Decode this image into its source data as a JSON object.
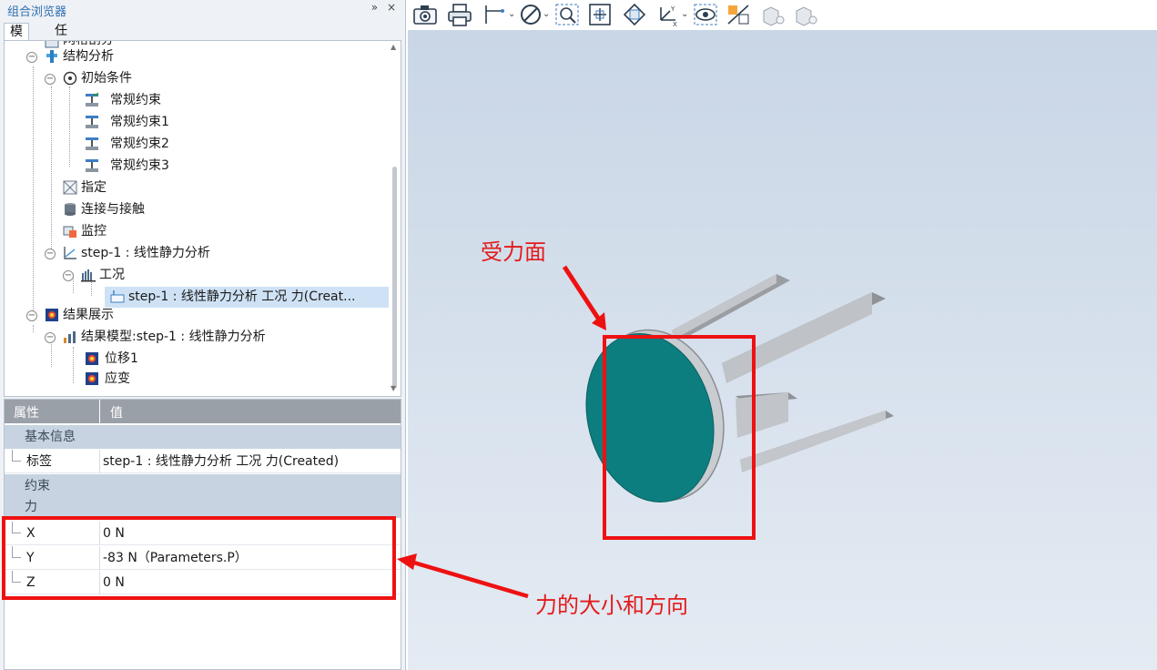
{
  "panel": {
    "title": "组合浏览器",
    "buttons": "» ×"
  },
  "tabs": [
    "模型",
    "任务"
  ],
  "tree": {
    "partial_top": "网格剖分",
    "items": [
      {
        "label": "结构分析",
        "icon": "analysis-icon"
      },
      {
        "label": "初始条件",
        "icon": "initial-condition-icon"
      },
      {
        "label": "常规约束",
        "icon": "constraint-icon"
      },
      {
        "label": "常规约束1",
        "icon": "constraint-icon"
      },
      {
        "label": "常规约束2",
        "icon": "constraint-icon"
      },
      {
        "label": "常规约束3",
        "icon": "constraint-icon"
      },
      {
        "label": "指定",
        "icon": "assign-icon"
      },
      {
        "label": "连接与接触",
        "icon": "contact-icon"
      },
      {
        "label": "监控",
        "icon": "monitor-icon"
      },
      {
        "label": "step-1 : 线性静力分析",
        "icon": "step-icon"
      },
      {
        "label": "工况",
        "icon": "load-case-icon"
      },
      {
        "label": "step-1 : 线性静力分析 工况 力(Creat...",
        "icon": "force-icon"
      },
      {
        "label": "结果展示",
        "icon": "results-icon"
      },
      {
        "label": "结果模型:step-1 : 线性静力分析",
        "icon": "result-model-icon"
      },
      {
        "label": "位移1",
        "icon": "contour-icon"
      },
      {
        "label": "应变",
        "icon": "contour-icon"
      }
    ]
  },
  "properties": {
    "header": {
      "property": "属性",
      "value": "值"
    },
    "basic_category": "基本信息",
    "tag_row": {
      "name": "标签",
      "value": "step-1 : 线性静力分析 工况 力(Created)"
    },
    "constraint_category": "约束",
    "force_category": "力",
    "x_row": {
      "name": "X",
      "value": "0 N"
    },
    "y_row": {
      "name": "Y",
      "value": "-83 N（Parameters.P）"
    },
    "z_row": {
      "name": "Z",
      "value": "0 N"
    }
  },
  "toolbar": {
    "icons": [
      "camera-icon",
      "print-icon",
      "axis-icon",
      "no-entry-icon",
      "zoom-box-icon",
      "fit-all-icon",
      "view-cube-icon",
      "axes-triad-icon",
      "eye-icon",
      "clip-plane-icon",
      "box-light-icon",
      "box-light-icon"
    ]
  },
  "annotations": {
    "face_label": "受力面",
    "force_label": "力的大小和方向"
  },
  "colors": {
    "accent": "#2f6fb0",
    "annotation_red": "#ee1111",
    "disk_teal": "#0d7e7f",
    "selection": "#cfe2f5",
    "property_header": "#9aa0a8",
    "category_row": "#c7d3e0"
  }
}
